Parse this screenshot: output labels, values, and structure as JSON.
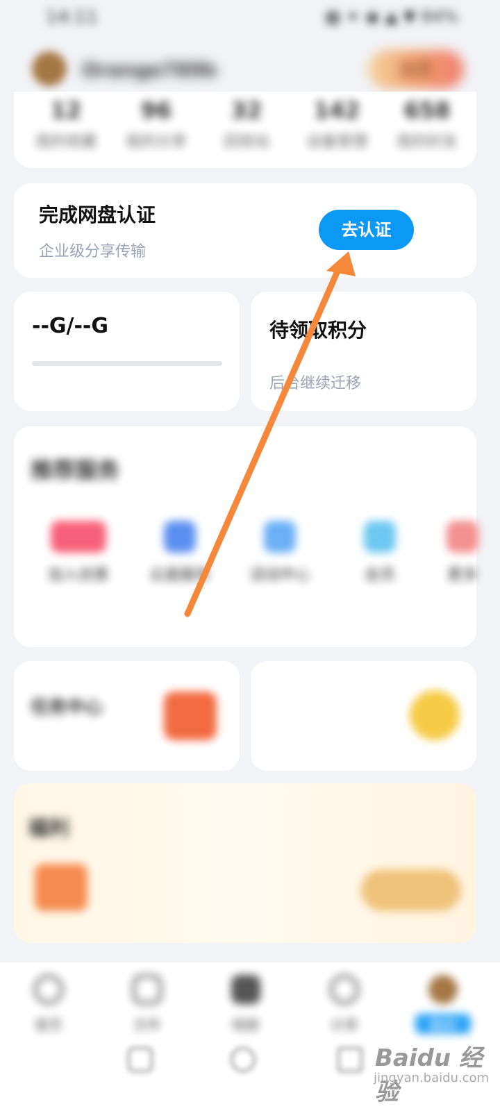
{
  "status_bar": {
    "time": "14:11",
    "indicators": "▦ ✦ ◉ ▲ ▼ 84%"
  },
  "header": {
    "username": "Orange789b",
    "vip_label": "会员"
  },
  "stats": [
    {
      "value": "12",
      "label": "我的收藏"
    },
    {
      "value": "96",
      "label": "我的分享"
    },
    {
      "value": "32",
      "label": "回收站"
    },
    {
      "value": "142",
      "label": "设备管理"
    },
    {
      "value": "658",
      "label": "我的好友"
    }
  ],
  "cert": {
    "title": "完成网盘认证",
    "subtitle": "企业级分享传输",
    "button": "去认证"
  },
  "storage": {
    "value": "--G/--G"
  },
  "points": {
    "title": "待领取积分",
    "subtitle": "后台继续迁移"
  },
  "services": {
    "title": "推荐服务",
    "items": [
      {
        "name": "加入创意",
        "desc": ""
      },
      {
        "name": "云盘服务",
        "desc": ""
      },
      {
        "name": "活动中心",
        "desc": ""
      },
      {
        "name": "会员",
        "desc": ""
      },
      {
        "name": "更多",
        "desc": ""
      }
    ]
  },
  "features": {
    "left_title": "任务中心",
    "left_sub": "",
    "right_title": "",
    "right_sub": "",
    "right_tag": ""
  },
  "welfare": {
    "title": "福利",
    "text": "",
    "sub": "",
    "button": ""
  },
  "bottom_nav": [
    {
      "label": "首页",
      "icon": "home-icon"
    },
    {
      "label": "文件",
      "icon": "folder-icon"
    },
    {
      "label": "相册",
      "icon": "photo-icon"
    },
    {
      "label": "分享",
      "icon": "share-icon"
    },
    {
      "label": "我的",
      "icon": "avatar-icon"
    }
  ],
  "watermark": {
    "brand": "Baidu 经验",
    "site": "jingyan.baidu.com"
  },
  "colors": {
    "cert_button": "#0c98f5",
    "arrow": "#f5883a",
    "page_bg": "#f2f3f7"
  }
}
